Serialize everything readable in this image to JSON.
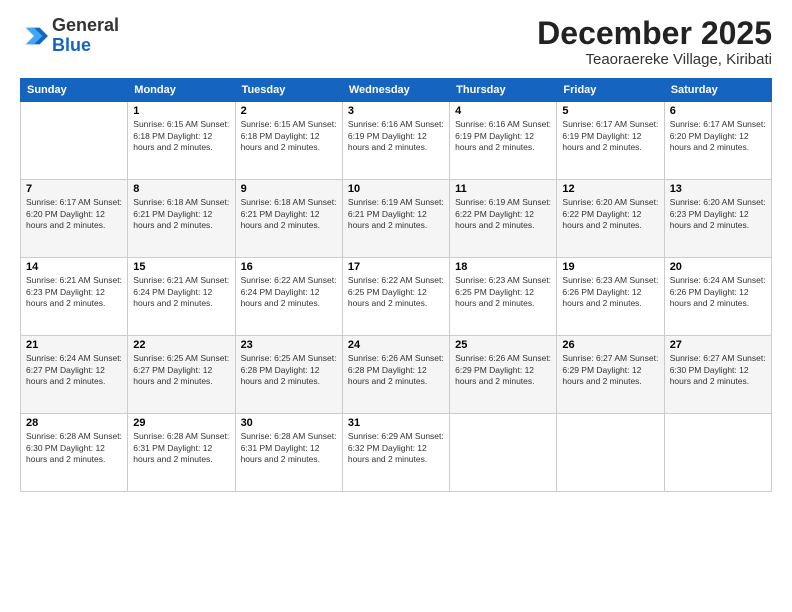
{
  "header": {
    "logo_general": "General",
    "logo_blue": "Blue",
    "month_title": "December 2025",
    "subtitle": "Teaoraereke Village, Kiribati"
  },
  "days_of_week": [
    "Sunday",
    "Monday",
    "Tuesday",
    "Wednesday",
    "Thursday",
    "Friday",
    "Saturday"
  ],
  "weeks": [
    [
      {
        "day": "",
        "info": ""
      },
      {
        "day": "1",
        "info": "Sunrise: 6:15 AM\nSunset: 6:18 PM\nDaylight: 12 hours\nand 2 minutes."
      },
      {
        "day": "2",
        "info": "Sunrise: 6:15 AM\nSunset: 6:18 PM\nDaylight: 12 hours\nand 2 minutes."
      },
      {
        "day": "3",
        "info": "Sunrise: 6:16 AM\nSunset: 6:19 PM\nDaylight: 12 hours\nand 2 minutes."
      },
      {
        "day": "4",
        "info": "Sunrise: 6:16 AM\nSunset: 6:19 PM\nDaylight: 12 hours\nand 2 minutes."
      },
      {
        "day": "5",
        "info": "Sunrise: 6:17 AM\nSunset: 6:19 PM\nDaylight: 12 hours\nand 2 minutes."
      },
      {
        "day": "6",
        "info": "Sunrise: 6:17 AM\nSunset: 6:20 PM\nDaylight: 12 hours\nand 2 minutes."
      }
    ],
    [
      {
        "day": "7",
        "info": ""
      },
      {
        "day": "8",
        "info": "Sunrise: 6:18 AM\nSunset: 6:21 PM\nDaylight: 12 hours\nand 2 minutes."
      },
      {
        "day": "9",
        "info": "Sunrise: 6:18 AM\nSunset: 6:21 PM\nDaylight: 12 hours\nand 2 minutes."
      },
      {
        "day": "10",
        "info": "Sunrise: 6:19 AM\nSunset: 6:21 PM\nDaylight: 12 hours\nand 2 minutes."
      },
      {
        "day": "11",
        "info": "Sunrise: 6:19 AM\nSunset: 6:22 PM\nDaylight: 12 hours\nand 2 minutes."
      },
      {
        "day": "12",
        "info": "Sunrise: 6:20 AM\nSunset: 6:22 PM\nDaylight: 12 hours\nand 2 minutes."
      },
      {
        "day": "13",
        "info": "Sunrise: 6:20 AM\nSunset: 6:23 PM\nDaylight: 12 hours\nand 2 minutes."
      }
    ],
    [
      {
        "day": "14",
        "info": ""
      },
      {
        "day": "15",
        "info": "Sunrise: 6:21 AM\nSunset: 6:24 PM\nDaylight: 12 hours\nand 2 minutes."
      },
      {
        "day": "16",
        "info": "Sunrise: 6:22 AM\nSunset: 6:24 PM\nDaylight: 12 hours\nand 2 minutes."
      },
      {
        "day": "17",
        "info": "Sunrise: 6:22 AM\nSunset: 6:25 PM\nDaylight: 12 hours\nand 2 minutes."
      },
      {
        "day": "18",
        "info": "Sunrise: 6:23 AM\nSunset: 6:25 PM\nDaylight: 12 hours\nand 2 minutes."
      },
      {
        "day": "19",
        "info": "Sunrise: 6:23 AM\nSunset: 6:26 PM\nDaylight: 12 hours\nand 2 minutes."
      },
      {
        "day": "20",
        "info": "Sunrise: 6:24 AM\nSunset: 6:26 PM\nDaylight: 12 hours\nand 2 minutes."
      }
    ],
    [
      {
        "day": "21",
        "info": ""
      },
      {
        "day": "22",
        "info": "Sunrise: 6:25 AM\nSunset: 6:27 PM\nDaylight: 12 hours\nand 2 minutes."
      },
      {
        "day": "23",
        "info": "Sunrise: 6:25 AM\nSunset: 6:28 PM\nDaylight: 12 hours\nand 2 minutes."
      },
      {
        "day": "24",
        "info": "Sunrise: 6:26 AM\nSunset: 6:28 PM\nDaylight: 12 hours\nand 2 minutes."
      },
      {
        "day": "25",
        "info": "Sunrise: 6:26 AM\nSunset: 6:29 PM\nDaylight: 12 hours\nand 2 minutes."
      },
      {
        "day": "26",
        "info": "Sunrise: 6:27 AM\nSunset: 6:29 PM\nDaylight: 12 hours\nand 2 minutes."
      },
      {
        "day": "27",
        "info": "Sunrise: 6:27 AM\nSunset: 6:30 PM\nDaylight: 12 hours\nand 2 minutes."
      }
    ],
    [
      {
        "day": "28",
        "info": "Sunrise: 6:28 AM\nSunset: 6:30 PM\nDaylight: 12 hours\nand 2 minutes."
      },
      {
        "day": "29",
        "info": "Sunrise: 6:28 AM\nSunset: 6:31 PM\nDaylight: 12 hours\nand 2 minutes."
      },
      {
        "day": "30",
        "info": "Sunrise: 6:28 AM\nSunset: 6:31 PM\nDaylight: 12 hours\nand 2 minutes."
      },
      {
        "day": "31",
        "info": "Sunrise: 6:29 AM\nSunset: 6:32 PM\nDaylight: 12 hours\nand 2 minutes."
      },
      {
        "day": "",
        "info": ""
      },
      {
        "day": "",
        "info": ""
      },
      {
        "day": "",
        "info": ""
      }
    ]
  ],
  "week_info_day7": [
    "Sunrise: 6:17 AM\nSunset: 6:20 PM\nDaylight: 12 hours\nand 2 minutes.",
    "Sunrise: 6:21 AM\nSunset: 6:23 PM\nDaylight: 12 hours\nand 2 minutes.",
    "Sunrise: 6:21 AM\nSunset: 6:23 PM\nDaylight: 12 hours\nand 2 minutes.",
    "Sunrise: 6:24 AM\nSunset: 6:27 PM\nDaylight: 12 hours\nand 2 minutes."
  ]
}
